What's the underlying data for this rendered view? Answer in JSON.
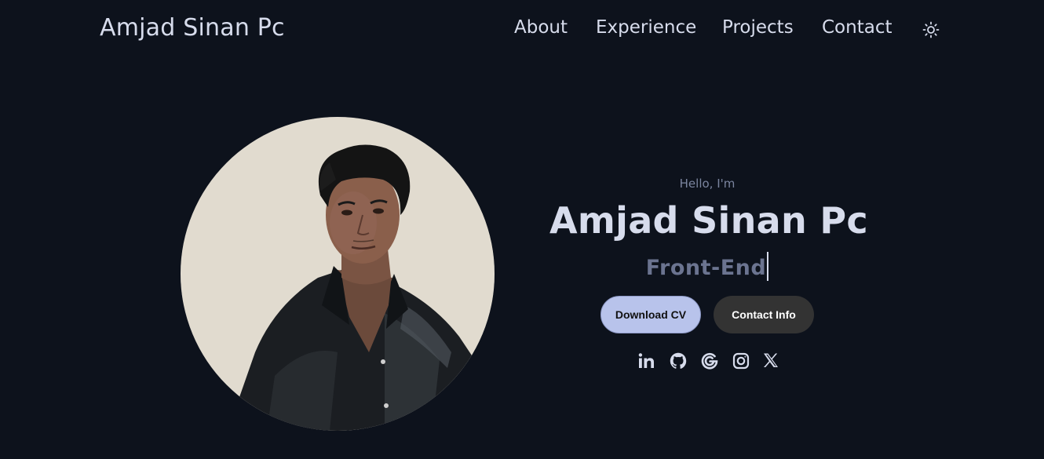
{
  "nav": {
    "logo": "Amjad Sinan Pc",
    "links": [
      "About",
      "Experience",
      "Projects",
      "Contact"
    ],
    "theme_icon": "sun-icon"
  },
  "hero": {
    "greeting": "Hello, I'm",
    "name": "Amjad Sinan Pc",
    "role": "Front-End",
    "buttons": {
      "download": "Download CV",
      "contact": "Contact Info"
    },
    "socials": [
      "linkedin-icon",
      "github-icon",
      "google-icon",
      "instagram-icon",
      "x-icon"
    ]
  },
  "colors": {
    "background": "#0d121c",
    "text": "#d7dcec",
    "muted": "#6b7490",
    "primary_button": "#b8c3eb",
    "secondary_button": "#333333"
  }
}
